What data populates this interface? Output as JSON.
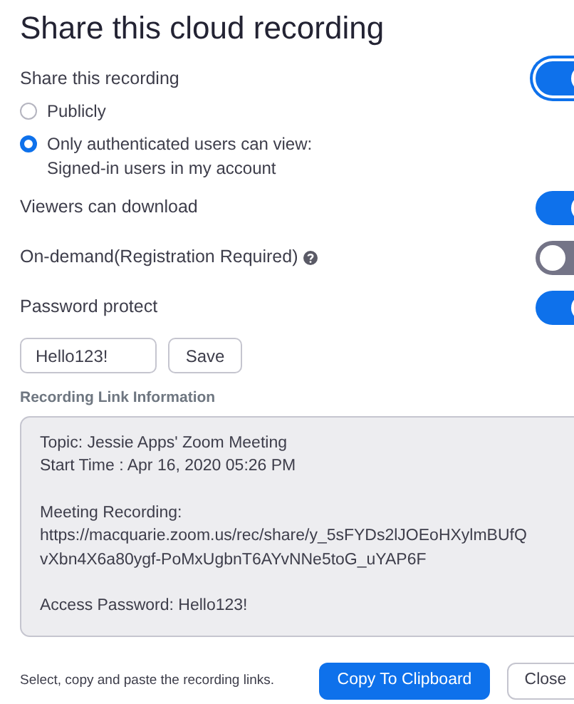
{
  "title": "Share this cloud recording",
  "share": {
    "label": "Share this recording",
    "on": true,
    "options": [
      {
        "label": "Publicly",
        "selected": false
      },
      {
        "label": "Only authenticated users can view:",
        "sublabel": "Signed-in users in my account",
        "selected": true
      }
    ]
  },
  "settings": [
    {
      "label": "Viewers can download",
      "on": true,
      "help": false
    },
    {
      "label": "On-demand(Registration Required)",
      "on": false,
      "help": true
    },
    {
      "label": "Password protect",
      "on": true,
      "help": false
    }
  ],
  "password": {
    "value": "Hello123!",
    "button": "Save"
  },
  "link_info": {
    "heading": "Recording Link Information",
    "paragraphs": [
      [
        "Topic: Jessie Apps' Zoom Meeting",
        "Start Time : Apr 16, 2020 05:26 PM"
      ],
      [
        "Meeting Recording:",
        "https://macquarie.zoom.us/rec/share/y_5sFYDs2lJOEoHXylmBUfQ",
        "vXbn4X6a80ygf-PoMxUgbnT6AYvNNe5toG_uYAP6F"
      ],
      [
        "Access Password: Hello123!"
      ]
    ]
  },
  "footer": {
    "hint": "Select, copy and paste the recording links.",
    "buttons": [
      {
        "label": "Copy To Clipboard",
        "kind": "primary"
      },
      {
        "label": "Close",
        "kind": "secondary"
      }
    ]
  }
}
